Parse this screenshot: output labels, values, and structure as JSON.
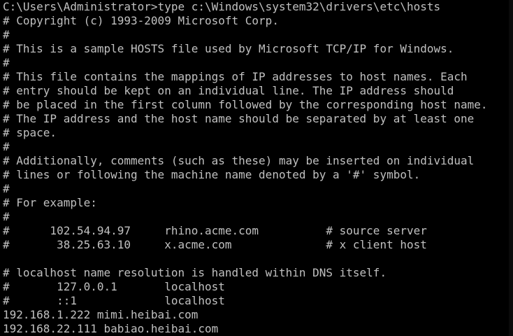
{
  "console": {
    "lines": [
      "C:\\Users\\Administrator>type c:\\Windows\\system32\\drivers\\etc\\hosts",
      "# Copyright (c) 1993-2009 Microsoft Corp.",
      "#",
      "# This is a sample HOSTS file used by Microsoft TCP/IP for Windows.",
      "#",
      "# This file contains the mappings of IP addresses to host names. Each",
      "# entry should be kept on an individual line. The IP address should",
      "# be placed in the first column followed by the corresponding host name.",
      "# The IP address and the host name should be separated by at least one",
      "# space.",
      "#",
      "# Additionally, comments (such as these) may be inserted on individual",
      "# lines or following the machine name denoted by a '#' symbol.",
      "#",
      "# For example:",
      "#",
      "#      102.54.94.97     rhino.acme.com          # source server",
      "#       38.25.63.10     x.acme.com              # x client host",
      "",
      "# localhost name resolution is handled within DNS itself.",
      "#       127.0.0.1       localhost",
      "#       ::1             localhost",
      "192.168.1.222 mimi.heibai.com",
      "192.168.22.111 babiao.heibai.com"
    ]
  }
}
